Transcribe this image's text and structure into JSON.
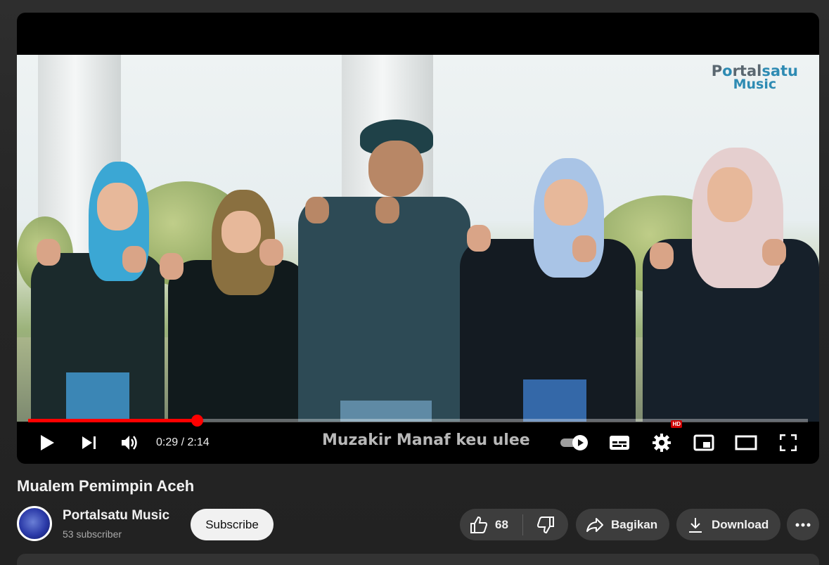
{
  "player": {
    "watermark_line1_a": "P",
    "watermark_line1_b": "o",
    "watermark_line1_c": "rtal",
    "watermark_line1_d": "satu",
    "watermark_line2": "Music",
    "time": "0:29 / 2:14",
    "subtitle": "Muzakir Manaf keu ulee",
    "progress_fraction": 0.2164,
    "hd_badge": "HD",
    "accent_color": "#ff0000"
  },
  "video": {
    "title": "Mualem Pemimpin Aceh"
  },
  "channel": {
    "name": "Portalsatu Music",
    "subscribers": "53 subscriber",
    "subscribe_label": "Subscribe"
  },
  "actions": {
    "like_count": "68",
    "share_label": "Bagikan",
    "download_label": "Download"
  },
  "icons": [
    "play-icon",
    "next-icon",
    "volume-icon",
    "autoplay-toggle",
    "subtitles-icon",
    "settings-icon",
    "miniplayer-icon",
    "theater-icon",
    "fullscreen-icon",
    "like-icon",
    "dislike-icon",
    "share-icon",
    "download-icon",
    "more-icon"
  ]
}
